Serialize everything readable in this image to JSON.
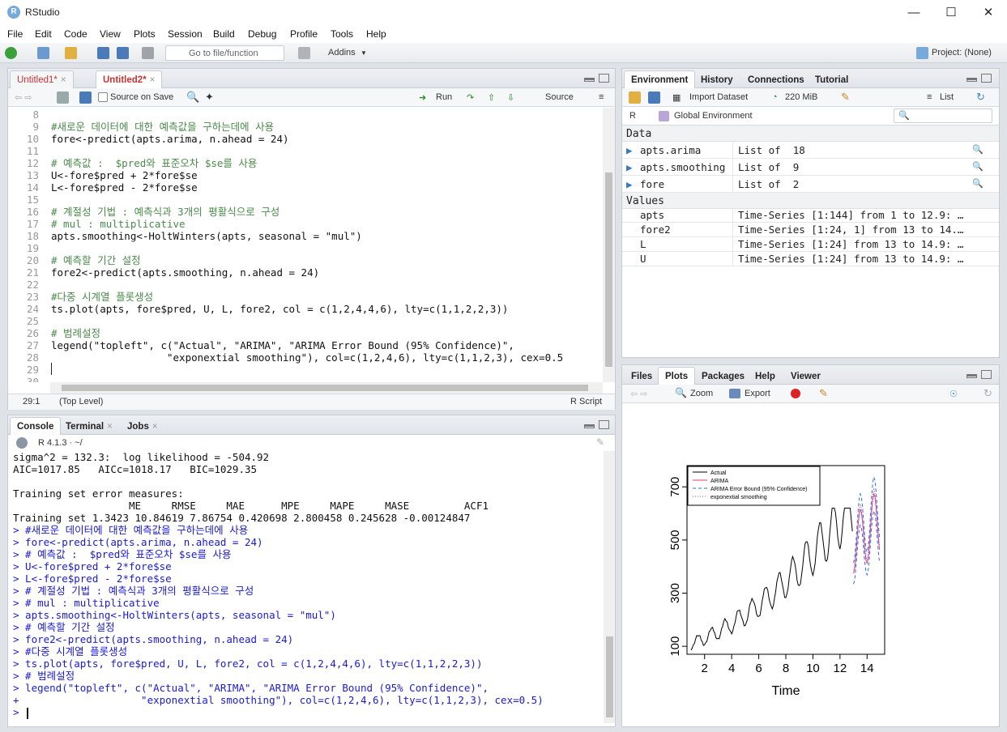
{
  "app": {
    "title": "RStudio",
    "icon": "R"
  },
  "menu": [
    "File",
    "Edit",
    "Code",
    "View",
    "Plots",
    "Session",
    "Build",
    "Debug",
    "Profile",
    "Tools",
    "Help"
  ],
  "toolbar": {
    "goto_placeholder": "Go to file/function",
    "addins": "Addins",
    "project": "Project: (None)"
  },
  "editor": {
    "tabs": [
      {
        "label": "Untitled1*"
      },
      {
        "label": "Untitled2*"
      }
    ],
    "source_on_save": "Source on Save",
    "run": "Run",
    "source": "Source",
    "lines": [
      {
        "n": "8",
        "t": ""
      },
      {
        "n": "9",
        "t": "#새로운 데이터에 대한 예측값을 구하는데에 사용",
        "c": true
      },
      {
        "n": "10",
        "t": "fore<-predict(apts.arima, n.ahead = 24)"
      },
      {
        "n": "11",
        "t": ""
      },
      {
        "n": "12",
        "t": "# 예측값 :  $pred와 표준오차 $se를 사용",
        "c": true
      },
      {
        "n": "13",
        "t": "U<-fore$pred + 2*fore$se"
      },
      {
        "n": "14",
        "t": "L<-fore$pred - 2*fore$se"
      },
      {
        "n": "15",
        "t": ""
      },
      {
        "n": "16",
        "t": "# 계절성 기법 : 예측식과 3개의 평활식으로 구성",
        "c": true
      },
      {
        "n": "17",
        "t": "# mul : multiplicative",
        "c": true
      },
      {
        "n": "18",
        "t": "apts.smoothing<-HoltWinters(apts, seasonal = \"mul\")"
      },
      {
        "n": "19",
        "t": ""
      },
      {
        "n": "20",
        "t": "# 예측할 기간 설정",
        "c": true
      },
      {
        "n": "21",
        "t": "fore2<-predict(apts.smoothing, n.ahead = 24)"
      },
      {
        "n": "22",
        "t": ""
      },
      {
        "n": "23",
        "t": "#다중 시계열 플롯생성",
        "c": true
      },
      {
        "n": "24",
        "t": "ts.plot(apts, fore$pred, U, L, fore2, col = c(1,2,4,4,6), lty=c(1,1,2,2,3))"
      },
      {
        "n": "25",
        "t": ""
      },
      {
        "n": "26",
        "t": "# 범례설정",
        "c": true
      },
      {
        "n": "27",
        "t": "legend(\"topleft\", c(\"Actual\", \"ARIMA\", \"ARIMA Error Bound (95% Confidence)\","
      },
      {
        "n": "28",
        "t": "                   \"exponextial smoothing\"), col=c(1,2,4,6), lty=c(1,1,2,3), cex=0.5"
      },
      {
        "n": "29",
        "t": ""
      },
      {
        "n": "30",
        "t": ""
      }
    ],
    "status_pos": "29:1",
    "status_scope": "(Top Level)",
    "status_type": "R Script"
  },
  "console": {
    "tabs": [
      {
        "label": "Console"
      },
      {
        "label": "Terminal"
      },
      {
        "label": "Jobs"
      }
    ],
    "version": "R 4.1.3 · ~/",
    "lines": [
      {
        "t": "sigma^2 = 132.3:  log likelihood = -504.92"
      },
      {
        "t": "AIC=1017.85   AICc=1018.17   BIC=1029.35"
      },
      {
        "t": ""
      },
      {
        "t": "Training set error measures:"
      },
      {
        "t": "                   ME     RMSE     MAE      MPE     MAPE     MASE         ACF1"
      },
      {
        "t": "Training set 1.3423 10.84619 7.86754 0.420698 2.800458 0.245628 -0.00124847"
      },
      {
        "t": "> #새로운 데이터에 대한 예측값을 구하는데에 사용",
        "i": true
      },
      {
        "t": "> fore<-predict(apts.arima, n.ahead = 24)",
        "i": true
      },
      {
        "t": "> # 예측값 :  $pred와 표준오차 $se를 사용",
        "i": true
      },
      {
        "t": "> U<-fore$pred + 2*fore$se",
        "i": true
      },
      {
        "t": "> L<-fore$pred - 2*fore$se",
        "i": true
      },
      {
        "t": "> # 계절성 기법 : 예측식과 3개의 평활식으로 구성",
        "i": true
      },
      {
        "t": "> # mul : multiplicative",
        "i": true
      },
      {
        "t": "> apts.smoothing<-HoltWinters(apts, seasonal = \"mul\")",
        "i": true
      },
      {
        "t": "> # 예측할 기간 설정",
        "i": true
      },
      {
        "t": "> fore2<-predict(apts.smoothing, n.ahead = 24)",
        "i": true
      },
      {
        "t": "> #다중 시계열 플롯생성",
        "i": true
      },
      {
        "t": "> ts.plot(apts, fore$pred, U, L, fore2, col = c(1,2,4,4,6), lty=c(1,1,2,2,3))",
        "i": true
      },
      {
        "t": "> # 범례설정",
        "i": true
      },
      {
        "t": "> legend(\"topleft\", c(\"Actual\", \"ARIMA\", \"ARIMA Error Bound (95% Confidence)\",",
        "i": true
      },
      {
        "t": "+                    \"exponextial smoothing\"), col=c(1,2,4,6), lty=c(1,1,2,3), cex=0.5)",
        "i": true
      },
      {
        "t": "> ",
        "i": true
      }
    ]
  },
  "environment": {
    "tabs": [
      {
        "label": "Environment"
      },
      {
        "label": "History"
      },
      {
        "label": "Connections"
      },
      {
        "label": "Tutorial"
      }
    ],
    "import": "Import Dataset",
    "memory": "220 MiB",
    "view": "List",
    "lang": "R",
    "scope": "Global Environment",
    "data_header": "Data",
    "values_header": "Values",
    "data": [
      {
        "name": "apts.arima",
        "value": "List of  18"
      },
      {
        "name": "apts.smoothing",
        "value": "List of  9"
      },
      {
        "name": "fore",
        "value": "List of  2"
      }
    ],
    "values": [
      {
        "name": "apts",
        "value": "Time-Series [1:144] from 1 to 12.9: …"
      },
      {
        "name": "fore2",
        "value": "Time-Series [1:24, 1] from 13 to 14.…"
      },
      {
        "name": "L",
        "value": "Time-Series [1:24] from 13 to 14.9: …"
      },
      {
        "name": "U",
        "value": "Time-Series [1:24] from 13 to 14.9: …"
      }
    ]
  },
  "files": {
    "tabs": [
      {
        "label": "Files"
      },
      {
        "label": "Plots"
      },
      {
        "label": "Packages"
      },
      {
        "label": "Help"
      },
      {
        "label": "Viewer"
      }
    ],
    "zoom": "Zoom",
    "export": "Export"
  },
  "chart_data": {
    "type": "line",
    "xlabel": "Time",
    "ylabel": "",
    "xlim": [
      0.7,
      15.3
    ],
    "ylim": [
      70,
      780
    ],
    "xticks": [
      "2",
      "4",
      "6",
      "8",
      "10",
      "12",
      "14"
    ],
    "yticks": [
      "100",
      "300",
      "500",
      "700"
    ],
    "legend": [
      "Actual",
      "ARIMA",
      "ARIMA Error Bound (95% Confidence)",
      "exponextial smoothing"
    ],
    "legend_position": "top-left",
    "colors": {
      "actual": "#000000",
      "arima": "#e0407a",
      "bound": "#2a6fe0",
      "smooth": "#c040c0"
    }
  }
}
